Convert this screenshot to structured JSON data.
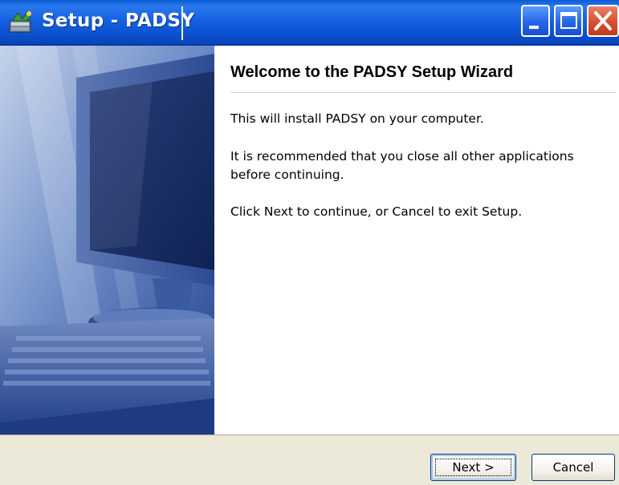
{
  "window": {
    "title": "Setup - PADSY",
    "icon": "setup-installer-icon",
    "controls": {
      "minimize_icon": "minimize-icon",
      "maximize_icon": "maximize-icon",
      "close_icon": "close-icon"
    }
  },
  "side_panel": {
    "image": "computer-monitor-keyboard-illustration"
  },
  "wizard": {
    "heading": "Welcome to the PADSY Setup Wizard",
    "paragraphs": [
      "This will install PADSY on your computer.",
      "It is recommended that you close all other applications before continuing.",
      "Click Next to continue, or Cancel to exit Setup."
    ]
  },
  "buttons": {
    "next_label": "Next >",
    "cancel_label": "Cancel"
  },
  "colors": {
    "titlebar_blue": "#0a5bd6",
    "close_red": "#d5512f",
    "dialog_face": "#ece9d8",
    "side_panel_blue": "#1f4a9c"
  }
}
